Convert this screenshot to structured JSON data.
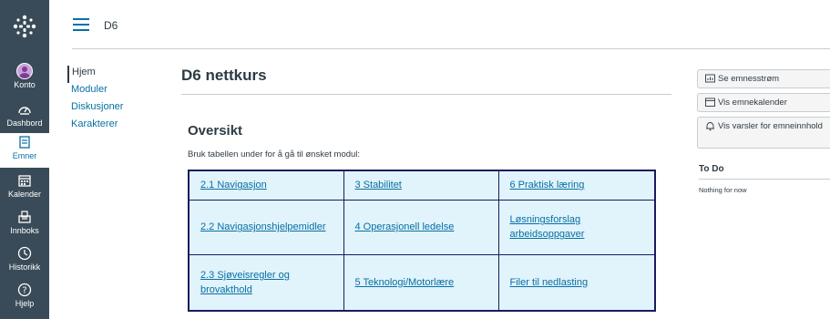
{
  "global_nav": {
    "items": [
      {
        "label": "Konto",
        "icon": "account-avatar-icon"
      },
      {
        "label": "Dashbord",
        "icon": "dashboard-icon"
      },
      {
        "label": "Emner",
        "icon": "courses-icon",
        "active": true
      },
      {
        "label": "Kalender",
        "icon": "calendar-icon"
      },
      {
        "label": "Innboks",
        "icon": "inbox-icon"
      },
      {
        "label": "Historikk",
        "icon": "history-icon"
      },
      {
        "label": "Hjelp",
        "icon": "help-icon"
      }
    ]
  },
  "header": {
    "breadcrumb": "D6"
  },
  "course_nav": {
    "items": [
      {
        "label": "Hjem",
        "active": true
      },
      {
        "label": "Moduler"
      },
      {
        "label": "Diskusjoner"
      },
      {
        "label": "Karakterer"
      }
    ]
  },
  "main": {
    "title": "D6 nettkurs",
    "subtitle": "Oversikt",
    "lead": "Bruk tabellen under for å gå til ønsket modul:",
    "table": [
      [
        "2.1 Navigasjon",
        "3 Stabilitet",
        "6 Praktisk læring"
      ],
      [
        "2.2 Navigasjonshjelpemidler",
        "4 Operasjonell ledelse",
        "Løsningsforslag arbeidsoppgaver"
      ],
      [
        "2.3 Sjøveisregler og brovakthold",
        "5 Teknologi/Motorlære",
        "Filer til nedlasting"
      ]
    ]
  },
  "sidebar": {
    "buttons": [
      {
        "label": "Se emnesstrøm",
        "icon": "stream-icon"
      },
      {
        "label": "Vis emnekalender",
        "icon": "calendar-icon"
      },
      {
        "label": "Vis varsler for emneinnhold",
        "icon": "bell-icon"
      }
    ],
    "todo_heading": "To Do",
    "todo_empty": "Nothing for now"
  },
  "colors": {
    "nav_bg": "#394b58",
    "link": "#0770a3",
    "table_bg": "#e1f3fb",
    "table_border": "#1a1a5e"
  }
}
